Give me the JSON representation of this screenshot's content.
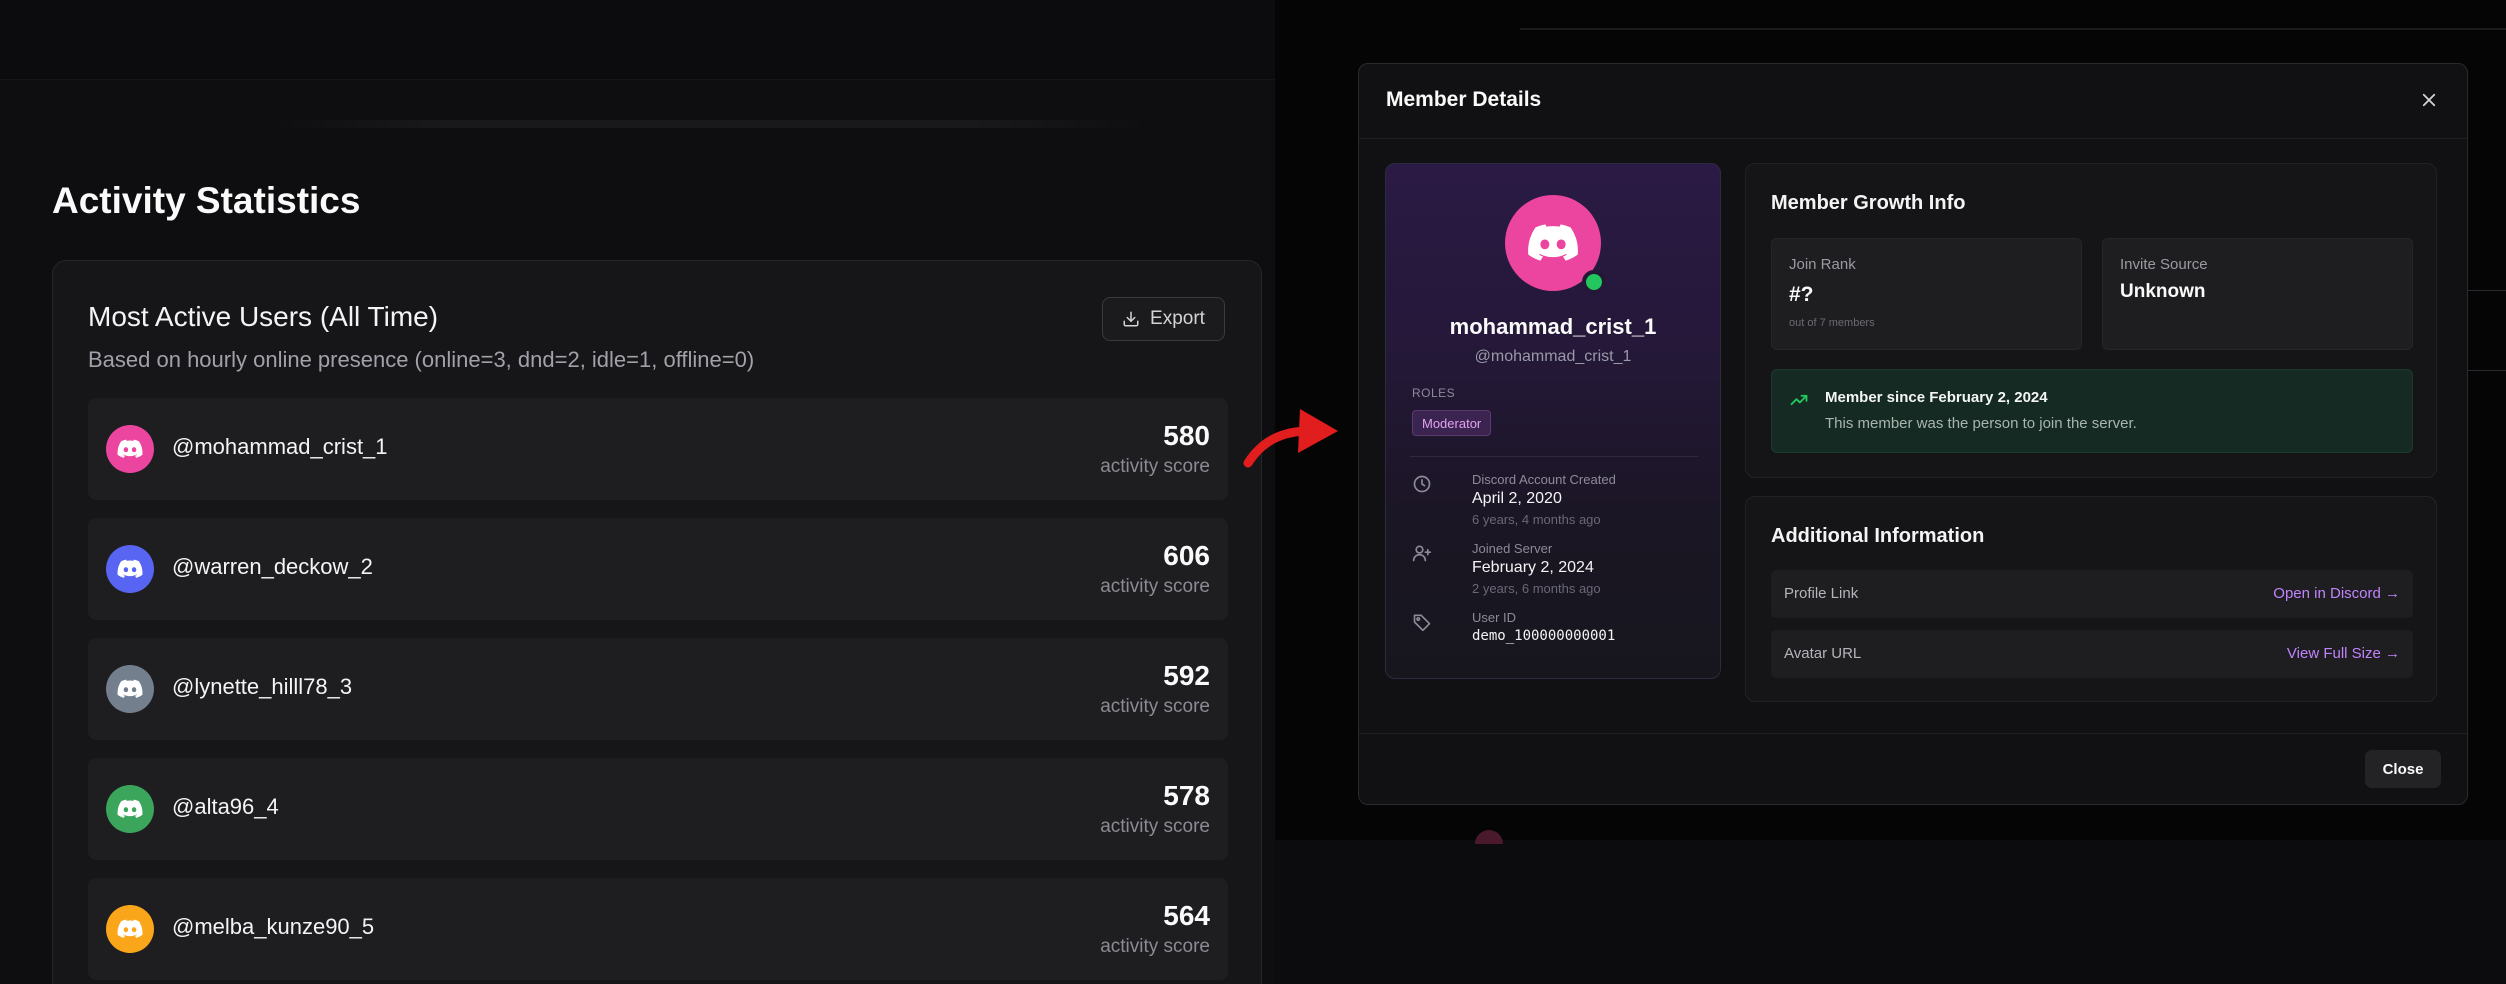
{
  "activity": {
    "heading": "Activity Statistics",
    "card_title": "Most Active Users (All Time)",
    "card_subtitle": "Based on hourly online presence (online=3, dnd=2, idle=1, offline=0)",
    "export_label": "Export",
    "score_label": "activity score",
    "users": [
      {
        "handle": "@mohammad_crist_1",
        "score": "580",
        "color": "#eb459f"
      },
      {
        "handle": "@warren_deckow_2",
        "score": "606",
        "color": "#5865f2"
      },
      {
        "handle": "@lynette_hilll78_3",
        "score": "592",
        "color": "#747f8d"
      },
      {
        "handle": "@alta96_4",
        "score": "578",
        "color": "#3ba55c"
      },
      {
        "handle": "@melba_kunze90_5",
        "score": "564",
        "color": "#faa61a"
      }
    ]
  },
  "modal": {
    "title": "Member Details",
    "profile": {
      "name": "mohammad_crist_1",
      "handle": "@mohammad_crist_1",
      "avatar_color": "#eb459f",
      "status_color": "#22c55e",
      "roles_label": "ROLES",
      "role": "Moderator",
      "account_created_label": "Discord Account Created",
      "account_created_value": "April 2, 2020",
      "account_created_sub": "6 years, 4 months ago",
      "joined_label": "Joined Server",
      "joined_value": "February 2, 2024",
      "joined_sub": "2 years, 6 months ago",
      "user_id_label": "User ID",
      "user_id_value": "demo_100000000001"
    },
    "growth": {
      "title": "Member Growth Info",
      "join_rank_label": "Join Rank",
      "join_rank_value": "#?",
      "join_rank_sub": "out of 7 members",
      "invite_source_label": "Invite Source",
      "invite_source_value": "Unknown",
      "member_since_title": "Member since February 2, 2024",
      "member_since_text": "This member was the person to join the server."
    },
    "additional": {
      "title": "Additional Information",
      "profile_link_label": "Profile Link",
      "profile_link_action": "Open in Discord →",
      "avatar_url_label": "Avatar URL",
      "avatar_url_action": "View Full Size →"
    },
    "close_label": "Close"
  }
}
